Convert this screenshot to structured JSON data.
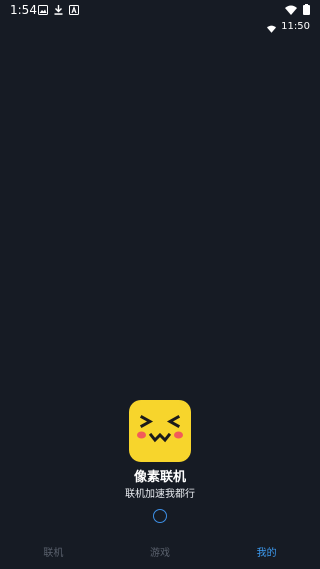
{
  "status_bar": {
    "time": "1:54",
    "clock_secondary": "11:50",
    "left_icons": [
      "image-icon",
      "download-icon",
      "notification-a-icon"
    ],
    "right_icons": [
      "wifi-icon",
      "battery-icon"
    ]
  },
  "splash": {
    "app_name": "像素联机",
    "tagline": "联机加速我都行",
    "icon": "pixel-face-icon",
    "icon_bg": "#f7d52c",
    "loader_color": "#3d8fe6"
  },
  "bottom_nav": {
    "items": [
      {
        "label": "联机",
        "active": false
      },
      {
        "label": "游戏",
        "active": false
      },
      {
        "label": "我的",
        "active": true
      }
    ],
    "active_color": "#3d9bf0",
    "inactive_color": "#5a616d"
  },
  "colors": {
    "background": "#161b24"
  }
}
